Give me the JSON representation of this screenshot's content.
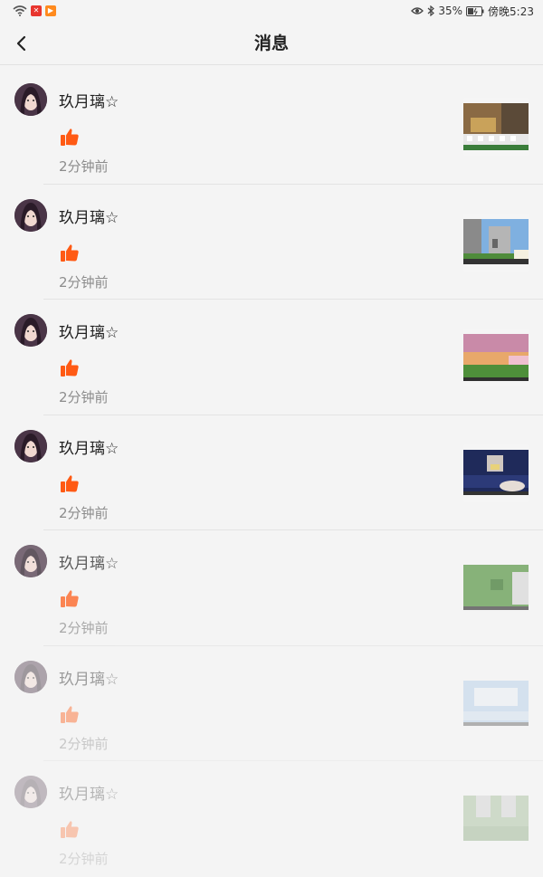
{
  "status_bar": {
    "battery": "35%",
    "time": "傍晚5:23"
  },
  "header": {
    "title": "消息"
  },
  "colors": {
    "like": "#ff5a14",
    "background": "#f4f4f4"
  },
  "messages": [
    {
      "user": "玖月璃☆",
      "action_icon": "thumbs-up-icon",
      "time": "2分钟前",
      "thumb_scene": "snow-village"
    },
    {
      "user": "玖月璃☆",
      "action_icon": "thumbs-up-icon",
      "time": "2分钟前",
      "thumb_scene": "stone-tower"
    },
    {
      "user": "玖月璃☆",
      "action_icon": "thumbs-up-icon",
      "time": "2分钟前",
      "thumb_scene": "sunset-field"
    },
    {
      "user": "玖月璃☆",
      "action_icon": "thumbs-up-icon",
      "time": "2分钟前",
      "thumb_scene": "night-build"
    },
    {
      "user": "玖月璃☆",
      "action_icon": "thumbs-up-icon",
      "time": "2分钟前",
      "thumb_scene": "green-field"
    },
    {
      "user": "玖月璃☆",
      "action_icon": "thumbs-up-icon",
      "time": "2分钟前",
      "thumb_scene": "ice-room"
    },
    {
      "user": "玖月璃☆",
      "action_icon": "thumbs-up-icon",
      "time": "2分钟前",
      "thumb_scene": "stone-gate"
    }
  ]
}
